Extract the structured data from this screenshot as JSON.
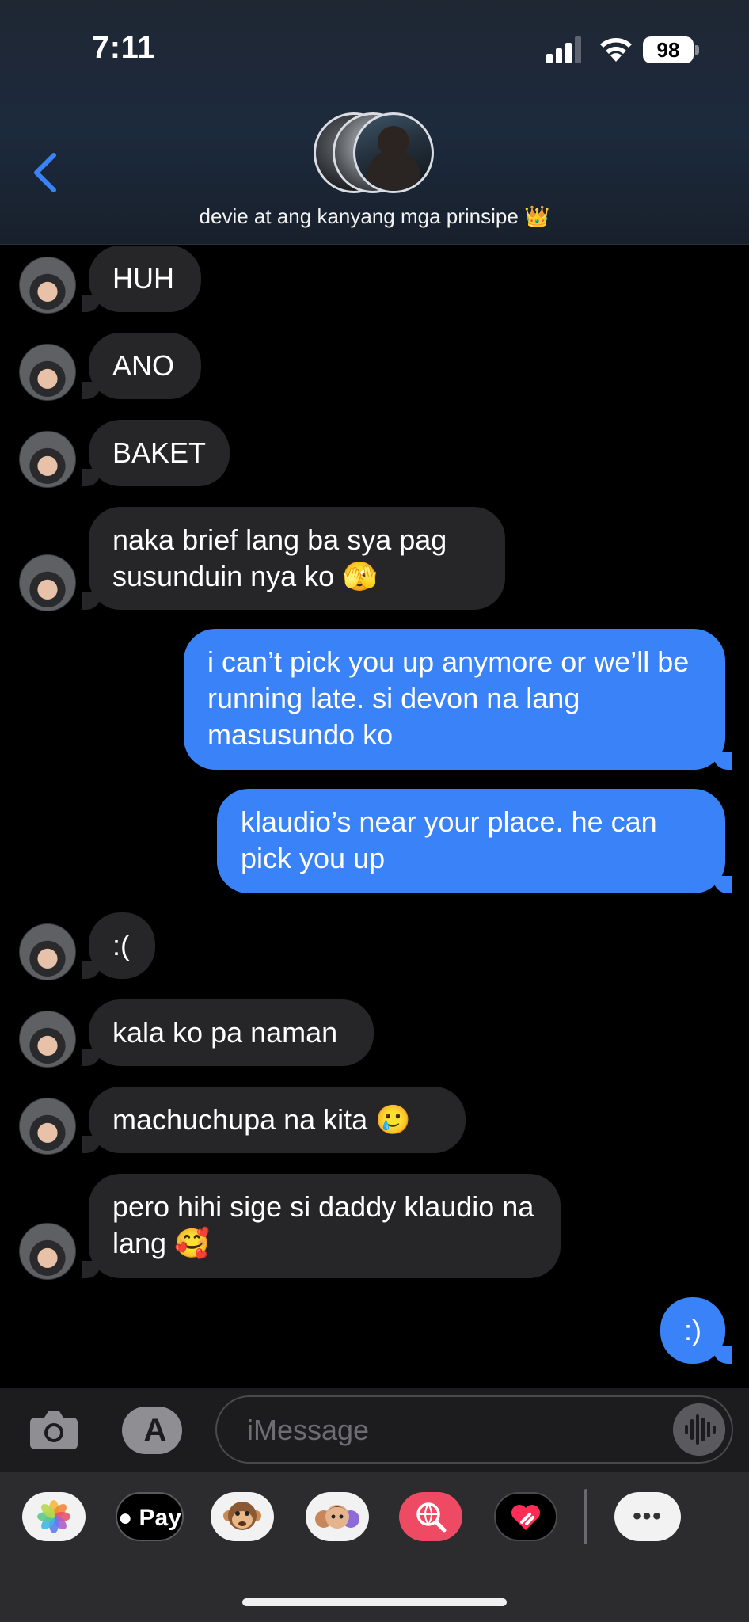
{
  "status_bar": {
    "time": "7:11",
    "battery": "98"
  },
  "conversation": {
    "title": "devie at ang kanyang mga prinsipe",
    "title_emoji": "👑"
  },
  "messages": [
    {
      "direction": "in",
      "text": "HUH"
    },
    {
      "direction": "in",
      "text": "ANO"
    },
    {
      "direction": "in",
      "text": "BAKET"
    },
    {
      "direction": "in",
      "text": "naka brief lang ba sya pag susunduin nya ko 🫣"
    },
    {
      "direction": "out",
      "text": "i can’t pick you up anymore or we’ll be running late. si devon na lang masusundo ko"
    },
    {
      "direction": "out",
      "text": "klaudio’s near your place. he can pick you up"
    },
    {
      "direction": "in",
      "text": ":("
    },
    {
      "direction": "in",
      "text": "kala ko pa naman"
    },
    {
      "direction": "in",
      "text": "machuchupa na kita 🥲"
    },
    {
      "direction": "in",
      "text": "pero hihi sige si daddy klaudio na lang 🥰"
    },
    {
      "direction": "out",
      "text": ":)"
    }
  ],
  "composer": {
    "placeholder": "iMessage"
  },
  "apps": {
    "pay_label": "Pay",
    "more_label": "•••"
  },
  "colors": {
    "outgoing_bubble": "#3a82f7",
    "incoming_bubble": "#262628",
    "background": "#000000"
  }
}
